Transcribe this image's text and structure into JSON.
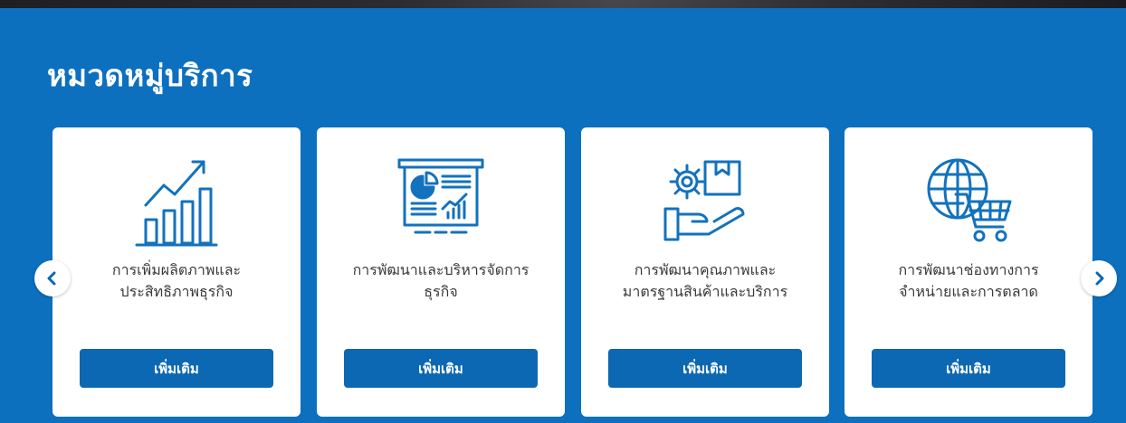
{
  "section": {
    "title": "หมวดหมู่บริการ"
  },
  "cards": [
    {
      "label_line1": "การเพิ่มผลิตภาพและ",
      "label_line2": "ประสิทธิภาพธุรกิจ",
      "button": "เพิ่มเติม",
      "icon": "growth-chart-icon"
    },
    {
      "label_line1": "การพัฒนาและบริหารจัดการ",
      "label_line2": "ธุรกิจ",
      "button": "เพิ่มเติม",
      "icon": "presentation-board-icon"
    },
    {
      "label_line1": "การพัฒนาคุณภาพและ",
      "label_line2": "มาตรฐานสินค้าและบริการ",
      "button": "เพิ่มเติม",
      "icon": "gear-box-hand-icon"
    },
    {
      "label_line1": "การพัฒนาช่องทางการ",
      "label_line2": "จำหน่ายและการตลาด",
      "button": "เพิ่มเติม",
      "icon": "globe-cart-icon"
    }
  ],
  "carousel": {
    "prev_icon": "chevron-left-icon",
    "next_icon": "chevron-right-icon"
  },
  "colors": {
    "background": "#0c70bf",
    "button": "#0c68b2",
    "icon": "#1272bd",
    "card": "#ffffff"
  }
}
